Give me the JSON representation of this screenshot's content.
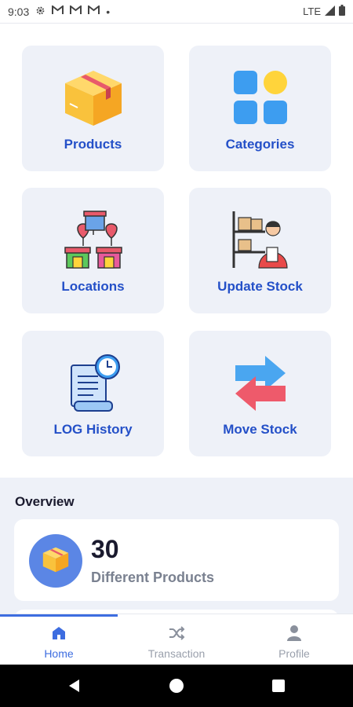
{
  "status_bar": {
    "time": "9:03",
    "dot": "•",
    "network": "LTE",
    "icons": [
      "gear-icon",
      "gmail-icon",
      "gmail-icon",
      "gmail-icon",
      "signal-icon",
      "battery-icon"
    ]
  },
  "menu": {
    "items": [
      {
        "label": "Products",
        "icon": "box-icon"
      },
      {
        "label": "Categories",
        "icon": "categories-icon"
      },
      {
        "label": "Locations",
        "icon": "locations-icon"
      },
      {
        "label": "Update Stock",
        "icon": "update-stock-icon"
      },
      {
        "label": "LOG History",
        "icon": "log-history-icon"
      },
      {
        "label": "Move Stock",
        "icon": "move-stock-icon"
      }
    ]
  },
  "overview": {
    "title": "Overview",
    "cards": [
      {
        "count": "30",
        "description": "Different Products",
        "icon": "box-icon"
      }
    ]
  },
  "bottom_nav": {
    "items": [
      {
        "label": "Home",
        "icon": "home-icon",
        "active": true
      },
      {
        "label": "Transaction",
        "icon": "shuffle-icon",
        "active": false
      },
      {
        "label": "Profile",
        "icon": "person-icon",
        "active": false
      }
    ]
  },
  "colors": {
    "accent": "#3d6de0",
    "tile_background": "#eef1f8",
    "label_blue": "#2450c8"
  }
}
